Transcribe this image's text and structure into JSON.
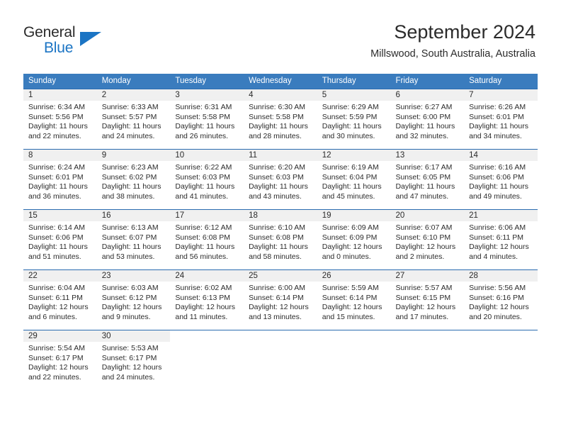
{
  "brand": {
    "name_part1": "General",
    "name_part2": "Blue",
    "triangle_color": "#1b74c4"
  },
  "header": {
    "title": "September 2024",
    "subtitle": "Millswood, South Australia, Australia"
  },
  "theme": {
    "header_bg": "#3a7cbe",
    "row_border": "#2b6cb0",
    "daynum_bg": "#f0f0f0",
    "text": "#2b2b2b"
  },
  "weekdays": [
    "Sunday",
    "Monday",
    "Tuesday",
    "Wednesday",
    "Thursday",
    "Friday",
    "Saturday"
  ],
  "weeks": [
    [
      {
        "day": "1",
        "sunrise": "Sunrise: 6:34 AM",
        "sunset": "Sunset: 5:56 PM",
        "daylight": "Daylight: 11 hours and 22 minutes."
      },
      {
        "day": "2",
        "sunrise": "Sunrise: 6:33 AM",
        "sunset": "Sunset: 5:57 PM",
        "daylight": "Daylight: 11 hours and 24 minutes."
      },
      {
        "day": "3",
        "sunrise": "Sunrise: 6:31 AM",
        "sunset": "Sunset: 5:58 PM",
        "daylight": "Daylight: 11 hours and 26 minutes."
      },
      {
        "day": "4",
        "sunrise": "Sunrise: 6:30 AM",
        "sunset": "Sunset: 5:58 PM",
        "daylight": "Daylight: 11 hours and 28 minutes."
      },
      {
        "day": "5",
        "sunrise": "Sunrise: 6:29 AM",
        "sunset": "Sunset: 5:59 PM",
        "daylight": "Daylight: 11 hours and 30 minutes."
      },
      {
        "day": "6",
        "sunrise": "Sunrise: 6:27 AM",
        "sunset": "Sunset: 6:00 PM",
        "daylight": "Daylight: 11 hours and 32 minutes."
      },
      {
        "day": "7",
        "sunrise": "Sunrise: 6:26 AM",
        "sunset": "Sunset: 6:01 PM",
        "daylight": "Daylight: 11 hours and 34 minutes."
      }
    ],
    [
      {
        "day": "8",
        "sunrise": "Sunrise: 6:24 AM",
        "sunset": "Sunset: 6:01 PM",
        "daylight": "Daylight: 11 hours and 36 minutes."
      },
      {
        "day": "9",
        "sunrise": "Sunrise: 6:23 AM",
        "sunset": "Sunset: 6:02 PM",
        "daylight": "Daylight: 11 hours and 38 minutes."
      },
      {
        "day": "10",
        "sunrise": "Sunrise: 6:22 AM",
        "sunset": "Sunset: 6:03 PM",
        "daylight": "Daylight: 11 hours and 41 minutes."
      },
      {
        "day": "11",
        "sunrise": "Sunrise: 6:20 AM",
        "sunset": "Sunset: 6:03 PM",
        "daylight": "Daylight: 11 hours and 43 minutes."
      },
      {
        "day": "12",
        "sunrise": "Sunrise: 6:19 AM",
        "sunset": "Sunset: 6:04 PM",
        "daylight": "Daylight: 11 hours and 45 minutes."
      },
      {
        "day": "13",
        "sunrise": "Sunrise: 6:17 AM",
        "sunset": "Sunset: 6:05 PM",
        "daylight": "Daylight: 11 hours and 47 minutes."
      },
      {
        "day": "14",
        "sunrise": "Sunrise: 6:16 AM",
        "sunset": "Sunset: 6:06 PM",
        "daylight": "Daylight: 11 hours and 49 minutes."
      }
    ],
    [
      {
        "day": "15",
        "sunrise": "Sunrise: 6:14 AM",
        "sunset": "Sunset: 6:06 PM",
        "daylight": "Daylight: 11 hours and 51 minutes."
      },
      {
        "day": "16",
        "sunrise": "Sunrise: 6:13 AM",
        "sunset": "Sunset: 6:07 PM",
        "daylight": "Daylight: 11 hours and 53 minutes."
      },
      {
        "day": "17",
        "sunrise": "Sunrise: 6:12 AM",
        "sunset": "Sunset: 6:08 PM",
        "daylight": "Daylight: 11 hours and 56 minutes."
      },
      {
        "day": "18",
        "sunrise": "Sunrise: 6:10 AM",
        "sunset": "Sunset: 6:08 PM",
        "daylight": "Daylight: 11 hours and 58 minutes."
      },
      {
        "day": "19",
        "sunrise": "Sunrise: 6:09 AM",
        "sunset": "Sunset: 6:09 PM",
        "daylight": "Daylight: 12 hours and 0 minutes."
      },
      {
        "day": "20",
        "sunrise": "Sunrise: 6:07 AM",
        "sunset": "Sunset: 6:10 PM",
        "daylight": "Daylight: 12 hours and 2 minutes."
      },
      {
        "day": "21",
        "sunrise": "Sunrise: 6:06 AM",
        "sunset": "Sunset: 6:11 PM",
        "daylight": "Daylight: 12 hours and 4 minutes."
      }
    ],
    [
      {
        "day": "22",
        "sunrise": "Sunrise: 6:04 AM",
        "sunset": "Sunset: 6:11 PM",
        "daylight": "Daylight: 12 hours and 6 minutes."
      },
      {
        "day": "23",
        "sunrise": "Sunrise: 6:03 AM",
        "sunset": "Sunset: 6:12 PM",
        "daylight": "Daylight: 12 hours and 9 minutes."
      },
      {
        "day": "24",
        "sunrise": "Sunrise: 6:02 AM",
        "sunset": "Sunset: 6:13 PM",
        "daylight": "Daylight: 12 hours and 11 minutes."
      },
      {
        "day": "25",
        "sunrise": "Sunrise: 6:00 AM",
        "sunset": "Sunset: 6:14 PM",
        "daylight": "Daylight: 12 hours and 13 minutes."
      },
      {
        "day": "26",
        "sunrise": "Sunrise: 5:59 AM",
        "sunset": "Sunset: 6:14 PM",
        "daylight": "Daylight: 12 hours and 15 minutes."
      },
      {
        "day": "27",
        "sunrise": "Sunrise: 5:57 AM",
        "sunset": "Sunset: 6:15 PM",
        "daylight": "Daylight: 12 hours and 17 minutes."
      },
      {
        "day": "28",
        "sunrise": "Sunrise: 5:56 AM",
        "sunset": "Sunset: 6:16 PM",
        "daylight": "Daylight: 12 hours and 20 minutes."
      }
    ],
    [
      {
        "day": "29",
        "sunrise": "Sunrise: 5:54 AM",
        "sunset": "Sunset: 6:17 PM",
        "daylight": "Daylight: 12 hours and 22 minutes."
      },
      {
        "day": "30",
        "sunrise": "Sunrise: 5:53 AM",
        "sunset": "Sunset: 6:17 PM",
        "daylight": "Daylight: 12 hours and 24 minutes."
      },
      {
        "day": "",
        "sunrise": "",
        "sunset": "",
        "daylight": ""
      },
      {
        "day": "",
        "sunrise": "",
        "sunset": "",
        "daylight": ""
      },
      {
        "day": "",
        "sunrise": "",
        "sunset": "",
        "daylight": ""
      },
      {
        "day": "",
        "sunrise": "",
        "sunset": "",
        "daylight": ""
      },
      {
        "day": "",
        "sunrise": "",
        "sunset": "",
        "daylight": ""
      }
    ]
  ]
}
